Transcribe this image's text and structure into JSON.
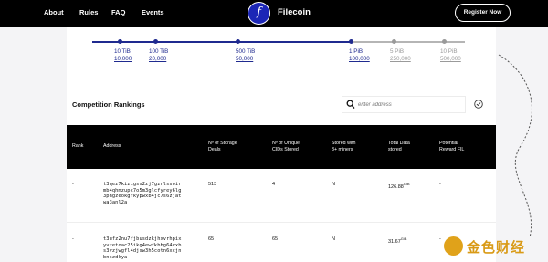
{
  "nav": {
    "links": [
      "About",
      "Rules",
      "FAQ",
      "Events"
    ],
    "logo_glyph": "f",
    "brand": "Filecoin",
    "register_label": "Register Now"
  },
  "milestones": [
    {
      "top": "10 TiB",
      "bottom": "10,000",
      "reached": true
    },
    {
      "top": "100 TiB",
      "bottom": "20,000",
      "reached": true
    },
    {
      "top": "500 TiB",
      "bottom": "50,000",
      "reached": true
    },
    {
      "top": "1 PiB",
      "bottom": "100,000",
      "reached": true
    },
    {
      "top": "5 PiB",
      "bottom": "250,000",
      "reached": false
    },
    {
      "top": "10 PiB",
      "bottom": "500,000",
      "reached": false
    }
  ],
  "rankings": {
    "title": "Competition Rankings",
    "search_placeholder": "enter address",
    "columns": {
      "rank": "Rank",
      "address": "Address",
      "deals": [
        "Nº of Storage",
        "Deals"
      ],
      "cids": [
        "Nº of Unique",
        "CIDs Stored"
      ],
      "miners": [
        "Stored with",
        "3+ miners"
      ],
      "total": [
        "Total Data",
        "stored"
      ],
      "reward": [
        "Potential",
        "Reward FIL"
      ]
    },
    "rows": [
      {
        "rank": "-",
        "address": "t3qez7kizigss2zj7gzrlssoir\nmb4qhmzupc7o5m3glcfyrey6lg\n3phgzeokgfkypwxb4jc7s6zjat\nwa3anl2a",
        "deals": "513",
        "cids": "4",
        "miners": "N",
        "total": "126.88",
        "total_unit": "GiB",
        "reward": "-"
      },
      {
        "rank": "-",
        "address": "t3ufz2nu7fjbusdzkjhxvrhpix\nyvzetoac25ikg4ewfkbbg64vxb\ns3vzjwgfl4djsw3h5cotn6xcjn\nbnszdkya",
        "deals": "65",
        "cids": "65",
        "miners": "N",
        "total": "31.67",
        "total_unit": "GiB",
        "reward": "-"
      }
    ]
  },
  "watermark": {
    "text": "金色财经"
  },
  "colors": {
    "nav_bg": "#000000",
    "logo_blue": "#1c26b6",
    "reached": "#1f2a8f",
    "unreached": "#9a9a9a"
  }
}
